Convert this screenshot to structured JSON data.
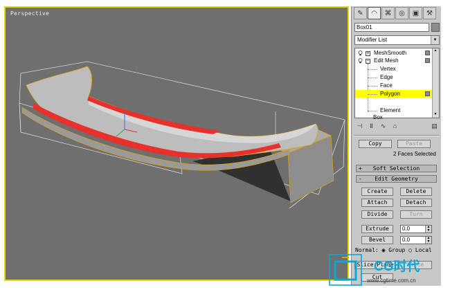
{
  "viewport": {
    "label": "Perspective"
  },
  "toolbar_tabs": [
    {
      "icon": "create-icon"
    },
    {
      "icon": "modify-icon"
    },
    {
      "icon": "hierarchy-icon"
    },
    {
      "icon": "motion-icon"
    },
    {
      "icon": "display-icon"
    },
    {
      "icon": "utilities-icon"
    }
  ],
  "object_name": "Box01",
  "modifier_list": "Modifier List",
  "stack": {
    "meshsmooth": "MeshSmooth",
    "edit_mesh": "Edit Mesh",
    "vertex": "Vertex",
    "edge": "Edge",
    "face": "Face",
    "polygon": "Polygon",
    "element": "Element",
    "box": "Box"
  },
  "selection": {
    "copy_label": "Copy",
    "paste_label": "Paste",
    "faces_selected": "2 Faces Selected"
  },
  "rollouts": {
    "soft_selection": "Soft Selection",
    "edit_geometry": "Edit Geometry",
    "soft_sign": "+",
    "edit_sign": "-"
  },
  "edit_geometry": {
    "create": "Create",
    "delete": "Delete",
    "attach": "Attach",
    "detach": "Detach",
    "divide": "Divide",
    "turn": "Turn",
    "extrude": "Extrude",
    "extrude_value": "0.0",
    "bevel": "Bevel",
    "bevel_value": "0.0",
    "normal_label": "Normal:",
    "group_label": "Group",
    "local_label": "Local",
    "slice_plane": "Slice Plane",
    "slice": "Slice",
    "cut": "Cut"
  },
  "watermark": {
    "brand": "CG时代",
    "url": "www.cgtime.com.cn"
  },
  "colors": {
    "viewport_bg": "#6f6f6f",
    "active_border": "#e6d800",
    "highlight": "#ffff00",
    "selected_faces": "#e8312a",
    "brand": "#0aa6d9"
  }
}
